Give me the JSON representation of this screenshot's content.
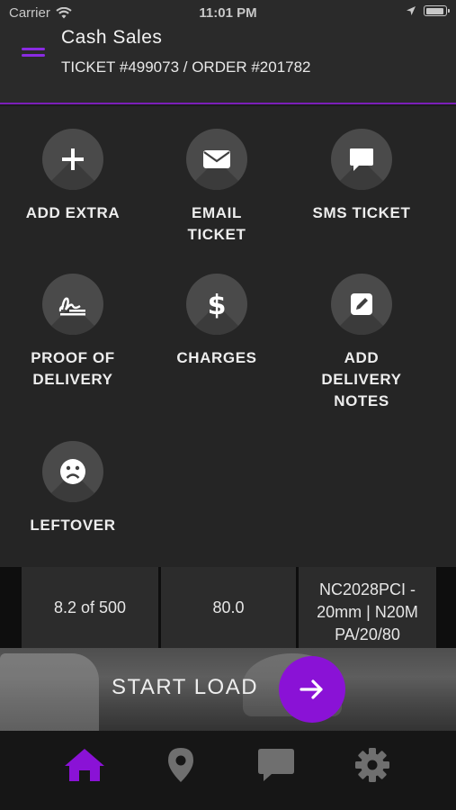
{
  "status_bar": {
    "carrier": "Carrier",
    "time": "11:01 PM"
  },
  "header": {
    "title": "Cash Sales",
    "subtitle": "TICKET #499073 / ORDER #201782",
    "accent_color": "#8a2be2"
  },
  "actions": [
    {
      "label": "ADD EXTRA",
      "icon": "plus-icon"
    },
    {
      "label": "EMAIL TICKET",
      "icon": "envelope-icon"
    },
    {
      "label": "SMS TICKET",
      "icon": "chat-bubble-icon"
    },
    {
      "label": "PROOF OF DELIVERY",
      "icon": "signature-icon"
    },
    {
      "label": "CHARGES",
      "icon": "dollar-icon"
    },
    {
      "label": "ADD DELIVERY NOTES",
      "icon": "edit-note-icon"
    },
    {
      "label": "LEFTOVER",
      "icon": "sad-face-icon"
    }
  ],
  "table_row": {
    "quantity": "8.2 of 500",
    "value": "80.0",
    "product": "NC2028PCI - 20mm | N20MPA/20/80"
  },
  "start_load": {
    "label": "START LOAD",
    "button_icon": "arrow-right-icon",
    "button_color": "#8a12d6"
  },
  "tab_bar": {
    "tabs": [
      {
        "name": "home",
        "icon": "home-icon",
        "active": true
      },
      {
        "name": "location",
        "icon": "map-pin-icon",
        "active": false
      },
      {
        "name": "messages",
        "icon": "message-icon",
        "active": false
      },
      {
        "name": "settings",
        "icon": "gear-icon",
        "active": false
      }
    ],
    "active_color": "#8a12d6",
    "inactive_color": "#6f6f6f"
  }
}
